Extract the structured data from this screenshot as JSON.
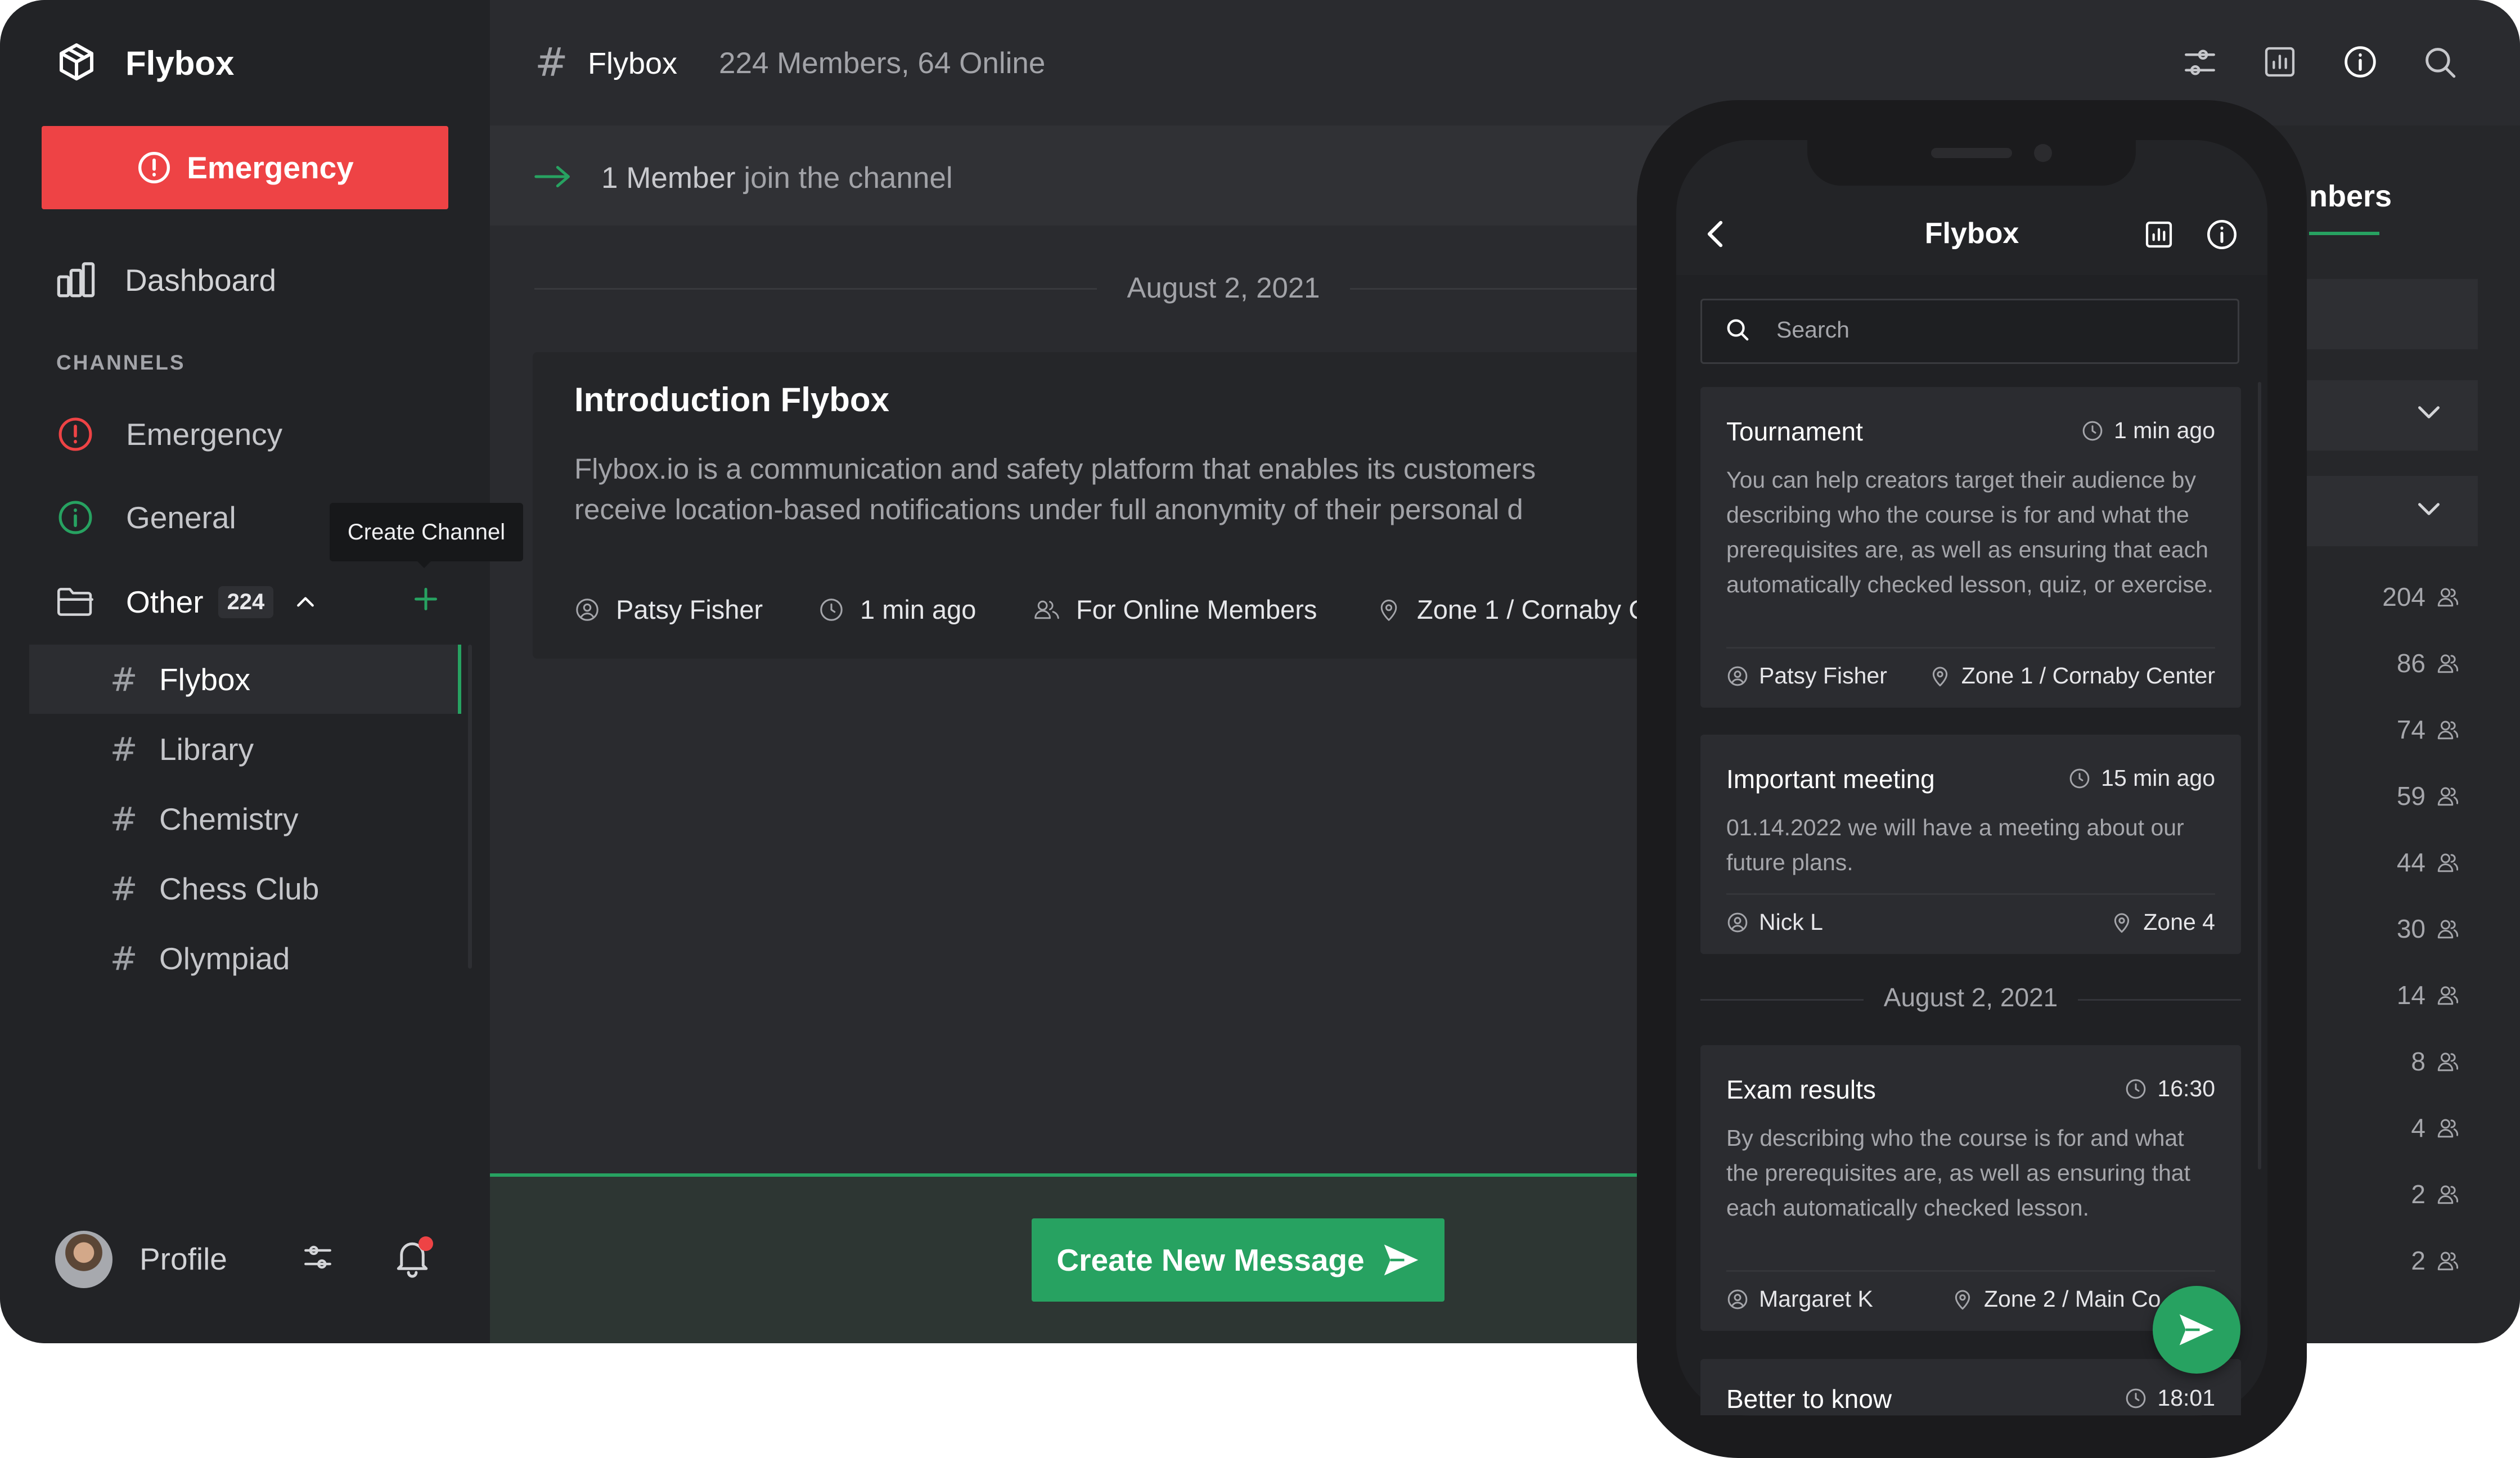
{
  "app": {
    "name": "Flybox"
  },
  "sidebar": {
    "emergency_button": "Emergency",
    "dashboard": "Dashboard",
    "channels_heading": "CHANNELS",
    "channel_emergency": "Emergency",
    "channel_general": "General",
    "folder": {
      "label": "Other",
      "count": "224"
    },
    "tooltip": "Create Channel",
    "subchannels": [
      "Flybox",
      "Library",
      "Chemistry",
      "Chess Club",
      "Olympiad"
    ],
    "profile": "Profile"
  },
  "header": {
    "channel": "Flybox",
    "stats": "224 Members, 64 Online"
  },
  "feed": {
    "join_notice_count": "1 Member",
    "join_notice_rest": "join the channel",
    "date": "August 2, 2021",
    "post": {
      "title": "Introduction Flybox",
      "body_line1": "Flybox.io is a communication and safety platform that enables its customers",
      "body_line2": "receive location-based notifications under full anonymity of their personal d",
      "author": "Patsy Fisher",
      "time": "1 min ago",
      "audience": "For Online Members",
      "zone": "Zone 1 / Cornaby C"
    },
    "compose_button": "Create New Message"
  },
  "right_panel": {
    "tab_partial": "nbers",
    "counts": [
      "204",
      "86",
      "74",
      "59",
      "44",
      "30",
      "14",
      "8",
      "4",
      "2",
      "2"
    ]
  },
  "phone": {
    "title": "Flybox",
    "search_placeholder": "Search",
    "date_divider": "August 2, 2021",
    "cards": [
      {
        "title": "Tournament",
        "time": "1 min ago",
        "body": "You can help creators target their audience by describing who the course is for and what the prerequisites are, as well as ensuring that each automatically checked lesson, quiz, or exercise.",
        "author": "Patsy Fisher",
        "zone": "Zone 1 / Cornaby Center"
      },
      {
        "title": "Important meeting",
        "time": "15 min ago",
        "body": "01.14.2022 we will have a meeting about our future plans.",
        "author": "Nick L",
        "zone": "Zone 4"
      },
      {
        "title": "Exam results",
        "time": "16:30",
        "body": "By describing who the course is for and what the prerequisites are, as well as ensuring that each automatically checked lesson.",
        "author": "Margaret K",
        "zone": "Zone 2 / Main Co"
      },
      {
        "title": "Better to know",
        "time": "18:01"
      }
    ]
  },
  "colors": {
    "accent_green": "#27a261",
    "danger_red": "#ee4345",
    "panel_dark": "#222326",
    "main_bg": "#2a2b2f"
  }
}
